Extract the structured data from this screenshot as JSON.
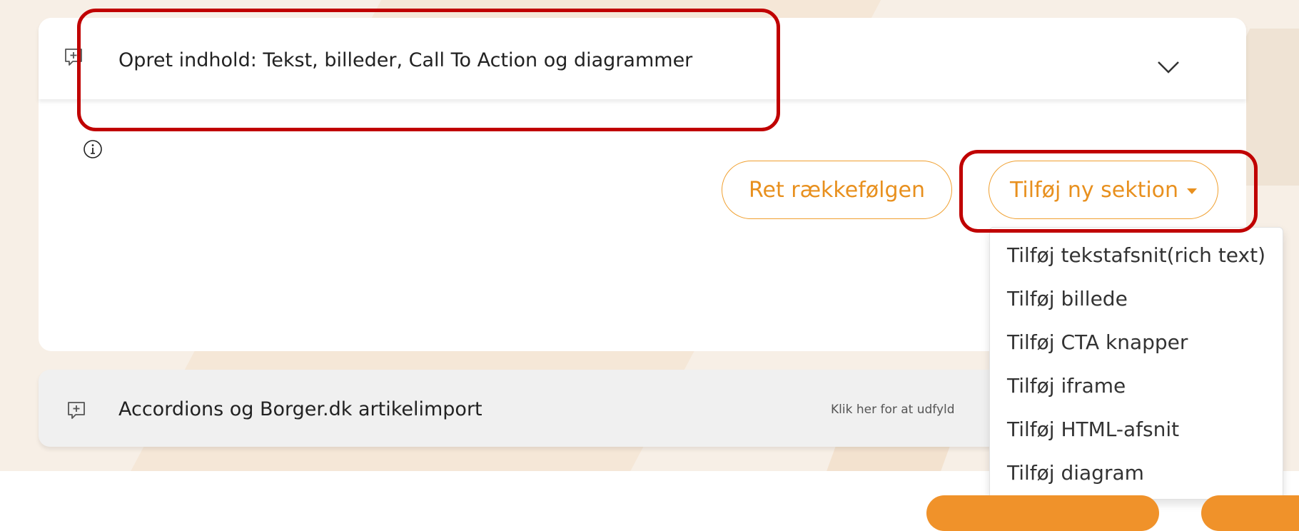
{
  "panel1": {
    "title": "Opret indhold: Tekst, billeder, Call To Action og diagrammer",
    "reorder_label": "Ret rækkefølgen",
    "add_section_label": "Tilføj ny sektion"
  },
  "dropdown": {
    "items": [
      "Tilføj tekstafsnit(rich text)",
      "Tilføj billede",
      "Tilføj CTA knapper",
      "Tilføj iframe",
      "Tilføj HTML-afsnit",
      "Tilføj diagram"
    ]
  },
  "panel2": {
    "title": "Accordions og Borger.dk artikelimport",
    "hint": "Klik her for at udfyld"
  },
  "icons": {
    "header": "comment-plus-icon",
    "info": "info-icon",
    "chevron": "chevron-down-icon"
  },
  "colors": {
    "accent": "#e8901e",
    "annotation": "#c00000"
  }
}
